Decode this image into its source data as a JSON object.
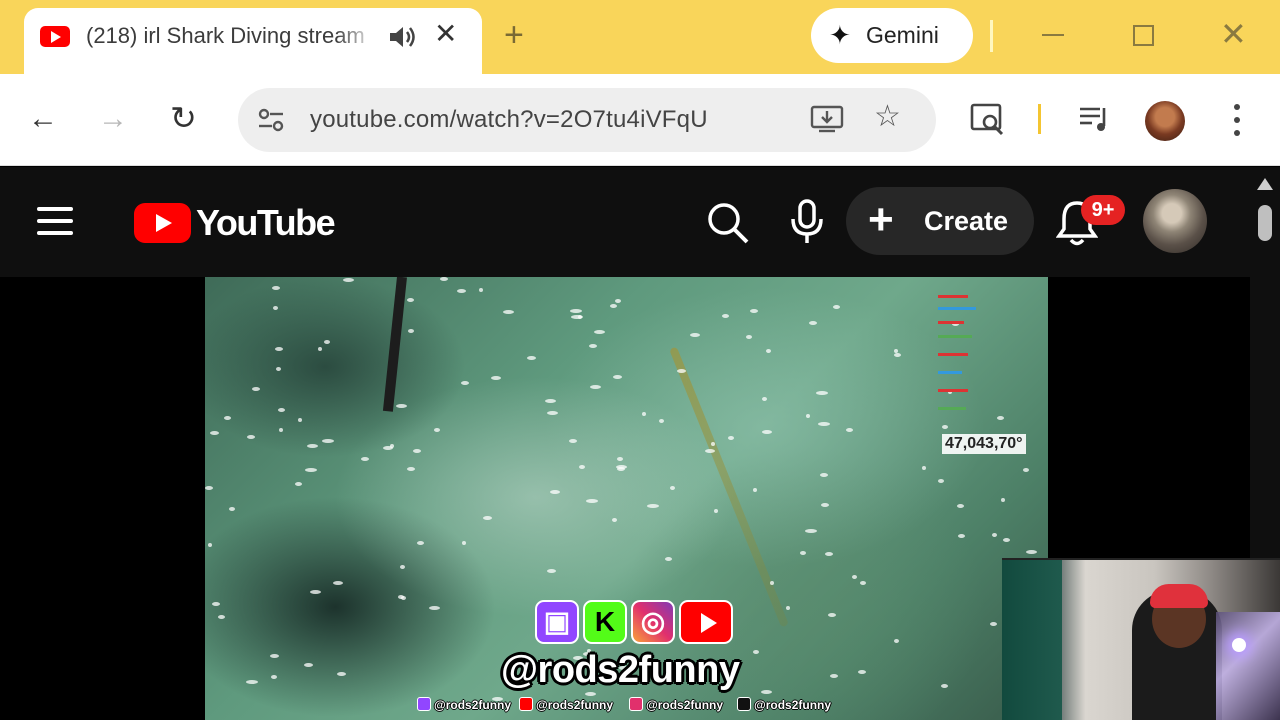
{
  "browser": {
    "tab": {
      "title": "(218) irl Shark Diving stream",
      "favicon": "youtube-favicon",
      "audio_icon": "speaker-icon",
      "close_icon": "close-icon"
    },
    "new_tab_icon": "plus-icon",
    "gemini_label": "Gemini",
    "window_controls": [
      "minimize",
      "maximize",
      "close"
    ],
    "url": "youtube.com/watch?v=2O7tu4iVFqU"
  },
  "youtube": {
    "logo_text": "YouTube",
    "create_label": "Create",
    "notification_badge": "9+"
  },
  "video": {
    "overlay_readout": "47,043,70°",
    "social_handle": "@rods2funny",
    "handle_strip": [
      "@rods2funny",
      "@rods2funny",
      "@rods2funny",
      "@rods2funny"
    ],
    "social_icons": [
      "twitch-icon",
      "kick-icon",
      "instagram-icon",
      "youtube-icon"
    ],
    "kick_letter": "K"
  },
  "colors": {
    "tabstrip": "#f9d55a",
    "youtube_red": "#ff0000",
    "yt_background": "#0f0f0f",
    "badge": "#e52222"
  }
}
